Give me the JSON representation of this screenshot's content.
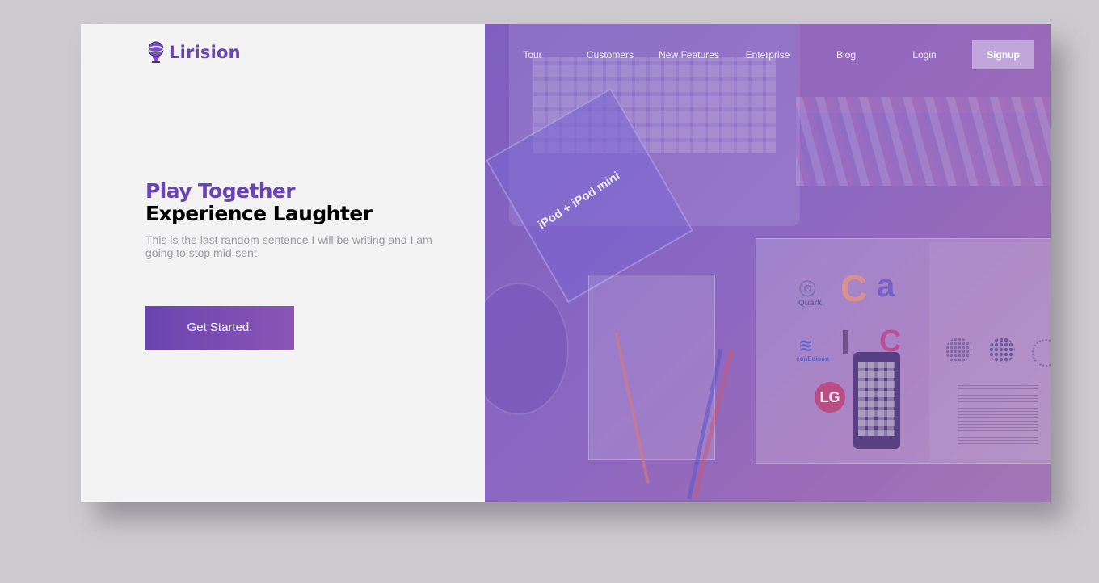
{
  "brand": {
    "name": "Lirision",
    "accent_color": "#6a43b6"
  },
  "nav": {
    "items": [
      {
        "label": "Tour"
      },
      {
        "label": "Customers"
      },
      {
        "label": "New Features"
      },
      {
        "label": "Enterprise"
      },
      {
        "label": "Blog"
      },
      {
        "label": "Login"
      }
    ],
    "signup_label": "Signup"
  },
  "hero": {
    "title_line1": "Play Together",
    "title_line2": "Experience Laughter",
    "subtitle": "This is the last random sentence I will be writing and I am going to stop mid-sent",
    "cta_label": "Get Started."
  },
  "photo": {
    "ipod_box_text": "iPod + iPod mini",
    "logo_quark": "Quark",
    "logo_conedison": "conEdison",
    "logo_lg": "LG"
  }
}
